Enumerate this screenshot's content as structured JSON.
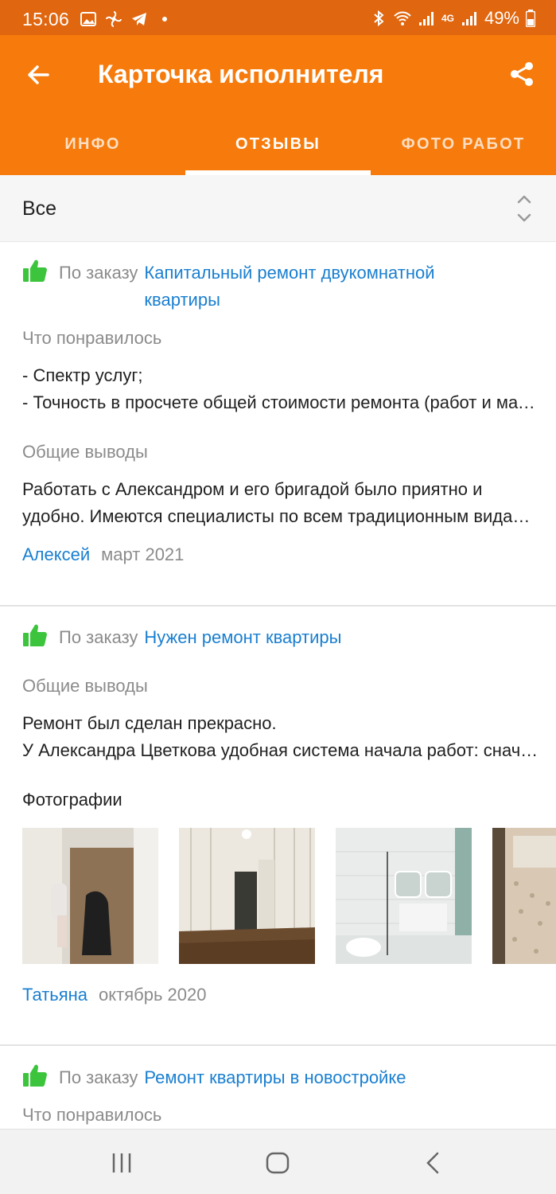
{
  "status_bar": {
    "time": "15:06",
    "battery": "49%",
    "network": "4G"
  },
  "app_bar": {
    "title": "Карточка исполнителя"
  },
  "tabs": [
    {
      "label": "ИНФО",
      "active": false
    },
    {
      "label": "ОТЗЫВЫ",
      "active": true
    },
    {
      "label": "ФОТО РАБОТ",
      "active": false
    }
  ],
  "filter": {
    "value": "Все"
  },
  "reviews": [
    {
      "order_prefix": "По заказу",
      "order_title_line1": "Капитальный ремонт двукомнатной",
      "order_title_line2": "квартиры",
      "liked_label": "Что понравилось",
      "liked_line1": "- Спектр услуг;",
      "liked_line2": "- Точность в просчете общей стоимости ремонта (работ и материалов)",
      "summary_label": "Общие выводы",
      "summary_line1": "Работать с Александром и его бригадой было приятно и",
      "summary_line2": "удобно. Имеются специалисты по всем традиционным видам работ",
      "author": "Алексей",
      "date": "март 2021"
    },
    {
      "order_prefix": "По заказу",
      "order_title_line1": "Нужен ремонт квартиры",
      "summary_label": "Общие выводы",
      "summary_line1": "Ремонт был сделан прекрасно.",
      "summary_line2": "У Александра Цветкова удобная система начала работ: сначала",
      "photos_label": "Фотографии",
      "author": "Татьяна",
      "date": "октябрь 2020"
    },
    {
      "order_prefix": "По заказу",
      "order_title_line1": "Ремонт квартиры в новостройке",
      "liked_label": "Что понравилось"
    }
  ],
  "colors": {
    "status_bar": "#e0660f",
    "app_bar": "#f67b0c",
    "link": "#1a7fd0",
    "thumb": "#3cc43c"
  },
  "icons": [
    "back-arrow-icon",
    "share-icon",
    "sort-chevrons-icon",
    "thumbs-up-icon",
    "recents-icon",
    "home-icon",
    "nav-back-icon"
  ]
}
